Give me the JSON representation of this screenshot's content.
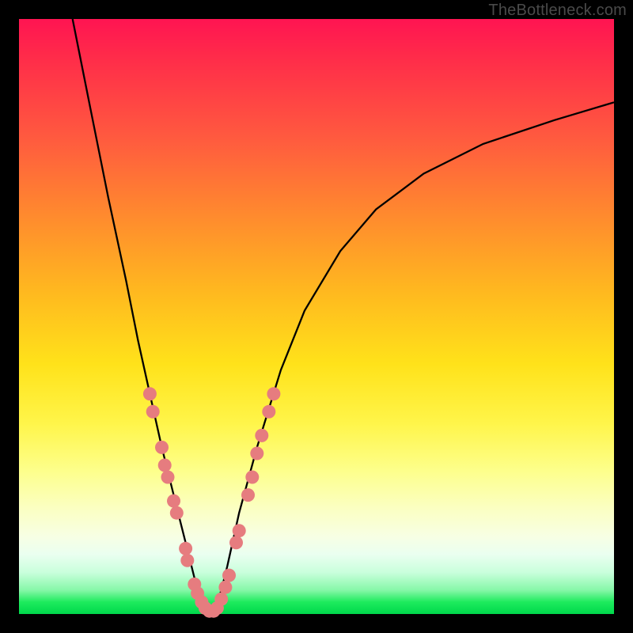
{
  "attribution": "TheBottleneck.com",
  "colors": {
    "frame": "#000000",
    "curve": "#000000",
    "dots": "#e67c7f",
    "gradient_stops": [
      "#ff1452",
      "#ff2a4a",
      "#ff5a3f",
      "#ff8a2e",
      "#ffb91f",
      "#ffe21a",
      "#fff54a",
      "#fdff8c",
      "#fbffc0",
      "#f7ffe4",
      "#eafff0",
      "#c9ffdc",
      "#86f7a8",
      "#1deb5d",
      "#00d84b"
    ]
  },
  "chart_data": {
    "type": "line",
    "title": "",
    "xlabel": "",
    "ylabel": "",
    "xlim": [
      0,
      100
    ],
    "ylim": [
      0,
      100
    ],
    "series": [
      {
        "name": "curve",
        "x": [
          9,
          12,
          15,
          18,
          20,
          22,
          24,
          25,
          26,
          27,
          28,
          29,
          30,
          31,
          32,
          33,
          34,
          35,
          37,
          40,
          44,
          48,
          54,
          60,
          68,
          78,
          90,
          100
        ],
        "values": [
          100,
          85,
          70,
          56,
          46,
          37,
          28,
          24,
          20,
          16,
          12,
          8,
          4,
          1,
          0,
          1,
          4,
          8,
          17,
          28,
          41,
          51,
          61,
          68,
          74,
          79,
          83,
          86
        ]
      }
    ],
    "annotations": {
      "type": "scatter",
      "name": "highlight-dots",
      "points": [
        {
          "x": 22.0,
          "y": 37
        },
        {
          "x": 22.5,
          "y": 34
        },
        {
          "x": 24.0,
          "y": 28
        },
        {
          "x": 24.5,
          "y": 25
        },
        {
          "x": 25.0,
          "y": 23
        },
        {
          "x": 26.0,
          "y": 19
        },
        {
          "x": 26.5,
          "y": 17
        },
        {
          "x": 28.0,
          "y": 11
        },
        {
          "x": 28.3,
          "y": 9
        },
        {
          "x": 29.5,
          "y": 5
        },
        {
          "x": 30.0,
          "y": 3.5
        },
        {
          "x": 30.7,
          "y": 2
        },
        {
          "x": 31.3,
          "y": 1
        },
        {
          "x": 32.0,
          "y": 0.5
        },
        {
          "x": 32.7,
          "y": 0.5
        },
        {
          "x": 33.3,
          "y": 1
        },
        {
          "x": 34.0,
          "y": 2.5
        },
        {
          "x": 34.7,
          "y": 4.5
        },
        {
          "x": 35.3,
          "y": 6.5
        },
        {
          "x": 36.5,
          "y": 12
        },
        {
          "x": 37.0,
          "y": 14
        },
        {
          "x": 38.5,
          "y": 20
        },
        {
          "x": 39.2,
          "y": 23
        },
        {
          "x": 40.0,
          "y": 27
        },
        {
          "x": 40.8,
          "y": 30
        },
        {
          "x": 42.0,
          "y": 34
        },
        {
          "x": 42.8,
          "y": 37
        }
      ]
    }
  }
}
